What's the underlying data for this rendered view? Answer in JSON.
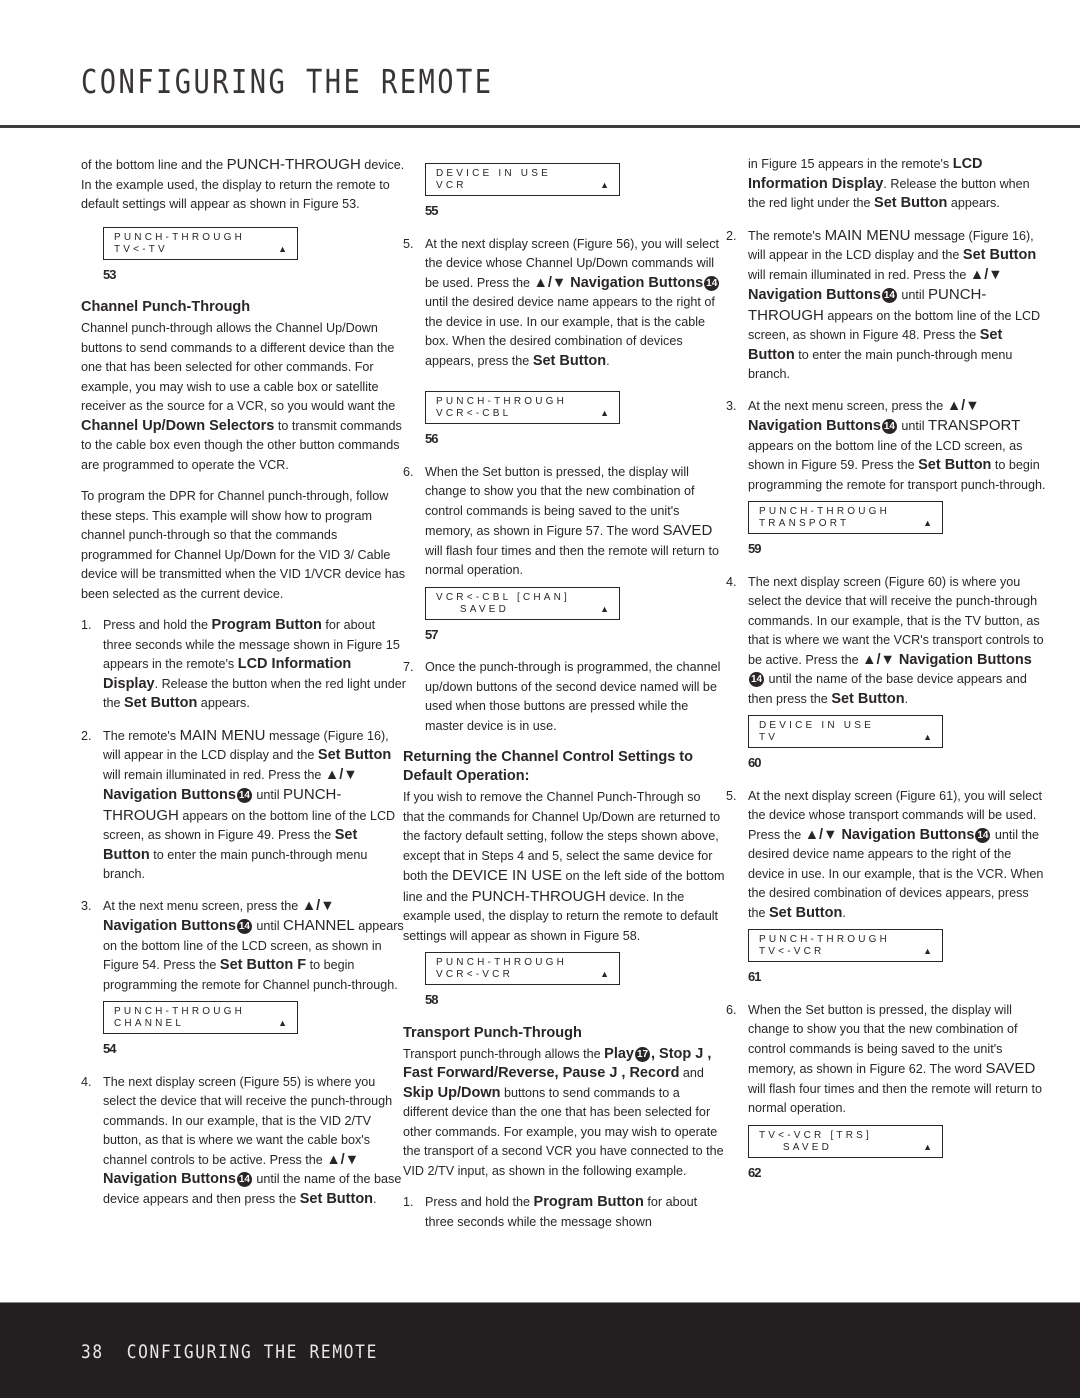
{
  "header": {
    "title": "CONFIGURING THE REMOTE"
  },
  "footer": {
    "page_number": "38",
    "section_title": "CONFIGURING THE REMOTE"
  },
  "col1": {
    "intro": {
      "t1": "of the bottom line and the ",
      "k1": "PUNCH-THROUGH",
      "t2": " device. In the example used, the display to return the remote to default settings will appear as shown in Figure 53."
    },
    "fig53": {
      "line1": "PUNCH-THROUGH",
      "line2": "TV<-TV",
      "arrow": "▲",
      "label": "53"
    },
    "channel_heading": "Channel Punch-Through",
    "channel_para": {
      "t1": "Channel punch-through allows the Channel Up/Down buttons to send commands to a different device than the one that has been selected for other commands. For example, you may wish to use a cable box or satellite receiver as the source for a VCR, so you would want the ",
      "b1": "Channel Up/Down Selectors",
      "t2": " to transmit commands to the cable box even though the other button commands are programmed to operate the VCR."
    },
    "program_para": "To program the DPR for Channel punch-through, follow these steps. This example will show how to program channel punch-through so that the commands programmed for Channel Up/Down for the VID 3/ Cable device will be transmitted when the VID 1/VCR device has been selected as the current device.",
    "steps": [
      {
        "num": "1.",
        "t1": "Press and hold the ",
        "b1": "Program Button",
        "t2": " for about three seconds while the message shown in Figure 15 appears in the remote's ",
        "b2": "LCD Information Display",
        "t3": ". Release the button when the red light under the ",
        "b3": "Set Button",
        "t4": " appears."
      },
      {
        "num": "2.",
        "t1": "The remote's ",
        "k1": "MAIN MENU",
        "t2": " message (Figure 16), will appear in the LCD display and the ",
        "b1": "Set Button",
        "t3": " will remain illuminated in red. Press the ",
        "b2": "▲/▼ Navigation Buttons",
        "callout": "14",
        "t4": " until ",
        "k2": "PUNCH-THROUGH",
        "t5": " appears on the bottom line of the LCD screen, as shown in Figure 49. Press the ",
        "b3": "Set Button",
        "t6": " to enter the main punch-through menu branch."
      },
      {
        "num": "3.",
        "t1": "At the next menu screen, press the ",
        "b1": "▲/▼ Navigation Buttons",
        "callout": "14",
        "t2": " until ",
        "k1": "CHANNEL",
        "t3": " appears on the bottom line of the LCD screen, as shown in Figure 54. Press the ",
        "b2": "Set Button F",
        "t4": " to begin programming the remote for Channel punch-through."
      },
      {
        "num": "4.",
        "t1": "The next display screen (Figure 55) is where you select the device that will receive the punch-through commands. In our example, that is the VID 2/TV button, as that is where we want the cable box's channel controls to be active. Press the ",
        "b1": "▲/▼ Navigation Buttons",
        "callout": "14",
        "t2": " until the name of the base device appears and then press the ",
        "b2": "Set Button",
        "t3": "."
      }
    ],
    "fig54": {
      "line1": "PUNCH-THROUGH",
      "line2": "CHANNEL",
      "arrow": "▲",
      "label": "54"
    }
  },
  "col2": {
    "fig55": {
      "line1": "DEVICE IN USE",
      "line2": "VCR",
      "arrow": "▲",
      "label": "55"
    },
    "step5": {
      "num": "5.",
      "t1": "At the next display screen (Figure 56), you will select the device whose Channel Up/Down commands will be used. Press the ",
      "b1": "▲/▼ Navigation Buttons",
      "callout": "14",
      "t2": " until the desired device name appears to the right of the device in use. In our example, that is the cable box. When the desired combination of devices appears, press the ",
      "b2": "Set Button",
      "t3": "."
    },
    "fig56": {
      "line1": "PUNCH-THROUGH",
      "line2": "VCR<-CBL",
      "arrow": "▲",
      "label": "56"
    },
    "step6": {
      "num": "6.",
      "t1": "When the Set button is pressed, the display will change to show you that the new combination of control commands is being saved to the unit's memory, as shown in Figure 57. The word ",
      "k1": "SAVED",
      "t2": " will flash four times and then the remote will return to normal operation."
    },
    "fig57": {
      "line1": "VCR<-CBL [CHAN]",
      "line2": "    SAVED",
      "arrow": "▲",
      "label": "57"
    },
    "step7": {
      "num": "7.",
      "t1": "Once the punch-through is programmed, the channel up/down buttons of the second device named will be used when those buttons are pressed while the master device is in use."
    },
    "return_heading": "Returning the Channel Control Settings to Default Operation:",
    "return_para": {
      "t1": "If you wish to remove the Channel Punch-Through so that the commands for Channel Up/Down are returned to the factory default setting, follow the steps shown above, except that in Steps 4 and 5, select the same device for both the ",
      "k1": "DEVICE IN USE",
      "t2": " on the left side of the bottom line and the ",
      "k2": "PUNCH-THROUGH",
      "t3": " device. In the example used, the display to return the remote to default settings will appear as shown in Figure 58."
    },
    "fig58": {
      "line1": "PUNCH-THROUGH",
      "line2": "VCR<-VCR",
      "arrow": "▲",
      "label": "58"
    },
    "transport_heading": "Transport Punch-Through",
    "transport_para": {
      "t1": "Transport punch-through allows the ",
      "b1": "Play",
      "callout": "17",
      "b2": ", Stop J , Fast Forward/Reverse, Pause J , Record",
      "t2": " and ",
      "b3": "Skip Up/Down",
      "t3": " buttons to send commands to a different device than the one that has been selected for other commands. For example, you may wish to operate the transport of a second VCR you have connected to the VID 2/TV input, as shown in the following example."
    },
    "step1": {
      "num": "1.",
      "t1": "Press and hold the ",
      "b1": "Program Button",
      "t2": " for about three seconds while the message shown"
    }
  },
  "col3": {
    "step1_cont": {
      "t1": "in Figure 15 appears in the remote's ",
      "b1": "LCD Information Display",
      "t2": ". Release the button when the red light under the ",
      "b2": "Set Button",
      "t3": " appears."
    },
    "step2": {
      "num": "2.",
      "t1": "The remote's ",
      "k1": "MAIN MENU",
      "t2": " message (Figure 16), will appear in the LCD display and the ",
      "b1": "Set Button",
      "t3": " will remain illuminated in red. Press the ",
      "b2": "▲/▼ Navigation Buttons",
      "callout": "14",
      "t4": " until ",
      "k2": "PUNCH-THROUGH",
      "t5": " appears on the bottom line of the LCD screen, as shown in Figure 48. Press the ",
      "b3": "Set Button",
      "t6": " to enter the main punch-through menu branch."
    },
    "step3": {
      "num": "3.",
      "t1": "At the next menu screen, press the ",
      "b1": "▲/▼ Navigation Buttons",
      "callout": "14",
      "t2": " until ",
      "k1": "TRANSPORT",
      "t3": " appears on the bottom line of the LCD screen, as shown in Figure 59. Press the ",
      "b2": "Set Button",
      "t4": " to begin programming the remote for transport punch-through."
    },
    "fig59": {
      "line1": "PUNCH-THROUGH",
      "line2": "TRANSPORT",
      "arrow": "▲",
      "label": "59"
    },
    "step4": {
      "num": "4.",
      "t1": "The next display screen (Figure 60) is where you select the device that will receive the punch-through commands. In our example, that is the TV button, as that is where we want the VCR's transport controls to be active. Press the ",
      "b1": "▲/▼ Navigation Buttons",
      "callout": "14",
      "t2": " until the name of the base device appears and then press the ",
      "b2": "Set Button",
      "t3": "."
    },
    "fig60": {
      "line1": "DEVICE IN USE",
      "line2": "TV",
      "arrow": "▲",
      "label": "60"
    },
    "step5": {
      "num": "5.",
      "t1": "At the next display screen (Figure 61), you will select the device whose transport commands will be used. Press the ",
      "b1": "▲/▼ Navigation Buttons",
      "callout": "14",
      "t2": " until the desired device name appears to the right of the device in use. In our example, that is the VCR. When the desired combination of devices appears, press the ",
      "b2": "Set Button",
      "t3": "."
    },
    "fig61": {
      "line1": "PUNCH-THROUGH",
      "line2": "TV<-VCR",
      "arrow": "▲",
      "label": "61"
    },
    "step6": {
      "num": "6.",
      "t1": "When the Set button is pressed, the display will change to show you that the new combination of control commands is being saved to the unit's memory, as shown in Figure 62. The word ",
      "k1": "SAVED",
      "t2": " will flash four times and then the remote will return to normal operation."
    },
    "fig62": {
      "line1": "TV<-VCR [TRS]",
      "line2": "    SAVED",
      "arrow": "▲",
      "label": "62"
    }
  }
}
